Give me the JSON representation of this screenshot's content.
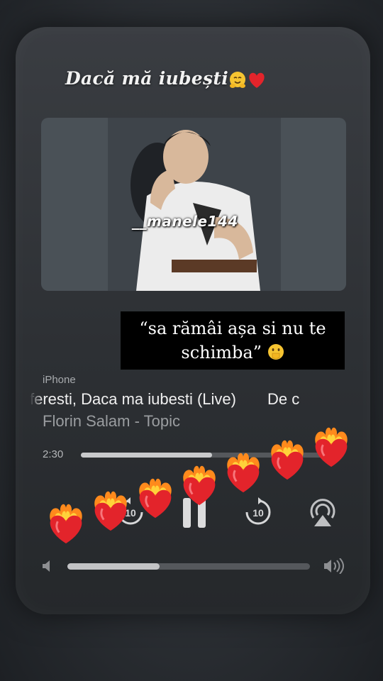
{
  "story": {
    "caption": "Dacă mă iubești",
    "caption_emojis": [
      "hugging-face-icon",
      "red-heart-icon"
    ],
    "watermark": "__manele144",
    "quote_line1": "“sa rămâi așa si nu te",
    "quote_line2": "schimba”",
    "quote_emoji": "face-with-hand-over-mouth-icon",
    "sticker_icon": "heart-on-fire-icon"
  },
  "player": {
    "device": "iPhone",
    "song_title": "feresti, Daca ma iubesti (Live)",
    "next_title_fragment": "De c",
    "artist": "Florin Salam - Topic",
    "elapsed": "2:30",
    "progress": 0.5,
    "volume": 0.38,
    "controls": [
      "skip-back-10-icon",
      "pause-icon",
      "skip-forward-10-icon",
      "airplay-icon"
    ]
  },
  "colors": {
    "accent_heart": "#e3242b",
    "text_primary": "#f0f0f0",
    "text_secondary": "#9a9da0"
  }
}
